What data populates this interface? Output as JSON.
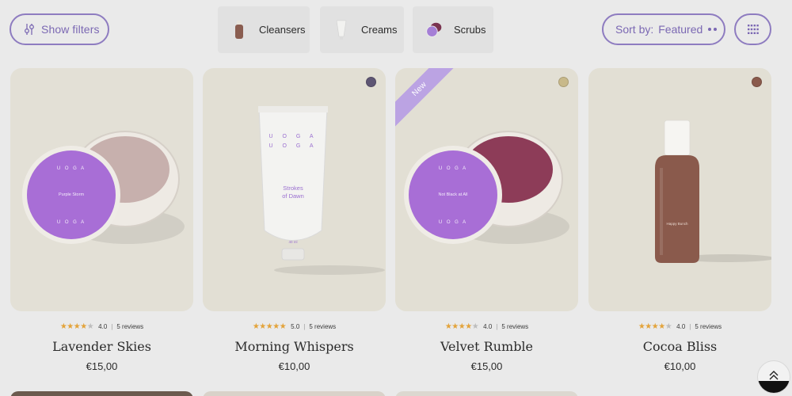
{
  "toolbar": {
    "filters_label": "Show filters",
    "sort_prefix": "Sort by:",
    "sort_value": "Featured"
  },
  "categories": [
    {
      "label": "Cleansers",
      "icon": "cleanser-bottle-icon"
    },
    {
      "label": "Creams",
      "icon": "cream-tube-icon"
    },
    {
      "label": "Scrubs",
      "icon": "scrub-jar-icon"
    }
  ],
  "products": [
    {
      "name": "Lavender Skies",
      "price": "€15,00",
      "rating": "4.0",
      "stars": 4,
      "reviews": "5 reviews",
      "jar_label": "Purple Storm",
      "brand": "U O G A",
      "swatch": null
    },
    {
      "name": "Morning Whispers",
      "price": "€10,00",
      "rating": "5.0",
      "stars": 5,
      "reviews": "5 reviews",
      "tube_label_line1": "Strokes",
      "tube_label_line2": "of Dawn",
      "brand_line1": "U O G A",
      "brand_line2": "U O G A",
      "tube_volume": "40 ml",
      "swatch": "#5e5674"
    },
    {
      "name": "Velvet Rumble",
      "price": "€15,00",
      "rating": "4.0",
      "stars": 4,
      "reviews": "5 reviews",
      "jar_label": "Not Black at All",
      "brand": "U O G A",
      "badge": "New",
      "swatch": "#c8b98a"
    },
    {
      "name": "Cocoa Bliss",
      "price": "€10,00",
      "rating": "4.0",
      "stars": 4,
      "reviews": "5 reviews",
      "bottle_label": "Happy Bunch",
      "swatch": "#8a5a4c"
    }
  ],
  "colors": {
    "accent": "#7b68b3",
    "star": "#e3a33a",
    "background": "#eaeaea",
    "card": "#e2dfd4"
  }
}
